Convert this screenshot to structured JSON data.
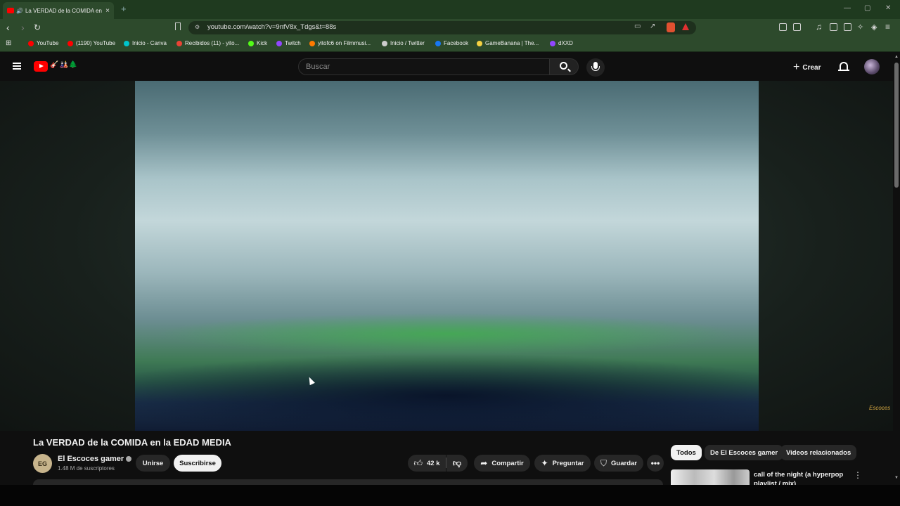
{
  "browser": {
    "tab_title": "La VERDAD de la COMIDA en",
    "url": "youtube.com/watch?v=9nfV8x_Tdgs&t=88s",
    "bookmarks": [
      {
        "label": "YouTube",
        "color": "#ff0000"
      },
      {
        "label": "(1190) YouTube",
        "color": "#ff0000"
      },
      {
        "label": "Inicio - Canva",
        "color": "#00c4cc"
      },
      {
        "label": "Recibidos (11) - yito...",
        "color": "#ea4335"
      },
      {
        "label": "Kick",
        "color": "#53fc18"
      },
      {
        "label": "Twitch",
        "color": "#9146ff"
      },
      {
        "label": "yitofc6 on Filmmusi...",
        "color": "#ff7a00"
      },
      {
        "label": "Inicio / Twitter",
        "color": "#cccccc"
      },
      {
        "label": "Facebook",
        "color": "#1877f2"
      },
      {
        "label": "GameBanana | The...",
        "color": "#f5d142"
      },
      {
        "label": "dXXD",
        "color": "#9146ff"
      }
    ]
  },
  "header": {
    "logo_suffix": "🎸🎎🌲",
    "search_placeholder": "Buscar",
    "create_label": "Crear"
  },
  "video": {
    "watermark": "Escoces"
  },
  "details": {
    "title": "La VERDAD de la COMIDA en la EDAD MEDIA",
    "channel_initials": "EG",
    "channel_name": "El Escoces gamer",
    "subscribers": "1.48 M de suscriptores",
    "join_label": "Unirse",
    "subscribe_label": "Suscribirse",
    "likes": "42 k",
    "share_label": "Compartir",
    "ask_label": "Preguntar",
    "save_label": "Guardar"
  },
  "sidebar": {
    "chips": [
      "Todos",
      "De El Escoces gamer",
      "Videos relacionados"
    ],
    "first_video_title": "call of the night (a hyperpop playlist / mix)"
  }
}
